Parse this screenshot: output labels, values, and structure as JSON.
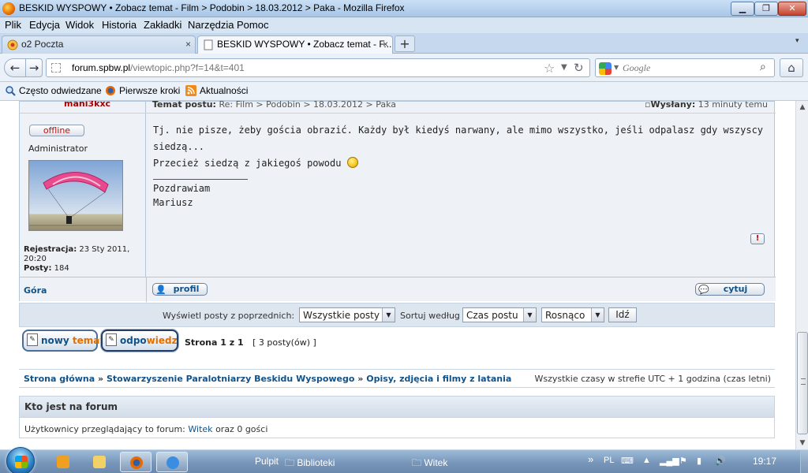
{
  "window": {
    "title": "BESKID WYSPOWY • Zobacz temat - Film > Podobin > 18.03.2012 > Paka - Mozilla Firefox",
    "controls": {
      "minimize": "▁",
      "maximize": "❐",
      "close": "✕"
    }
  },
  "menu": [
    "Plik",
    "Edycja",
    "Widok",
    "Historia",
    "Zakładki",
    "Narzędzia",
    "Pomoc"
  ],
  "tabs": [
    {
      "label": "o2 Poczta",
      "close": "×"
    },
    {
      "label": "BESKID WYSPOWY • Zobacz temat - F...",
      "close": "×"
    }
  ],
  "newtab_label": "+",
  "navigation": {
    "back": "←",
    "forward": "→",
    "url_domain": "forum.spbw.pl",
    "url_path": "/viewtopic.php?f=14&t=401",
    "search_placeholder": "Google",
    "home": "⌂"
  },
  "bookmarks": [
    {
      "label": "Często odwiedzane",
      "icon": "magnifier-bookmark-icon"
    },
    {
      "label": "Pierwsze kroki",
      "icon": "firefox-icon"
    },
    {
      "label": "Aktualności",
      "icon": "rss-icon"
    }
  ],
  "post": {
    "author": "mani3kxc",
    "subject_label": "Temat postu:",
    "subject": "Re: Film > Podobin > 18.03.2012 > Paka",
    "posted_label": "Wysłany:",
    "posted": "13 minuty temu",
    "status": "offline",
    "rank": "Administrator",
    "registration_label": "Rejestracja:",
    "registration": "23 Sty 2011, 20:20",
    "posts_label": "Posty:",
    "posts_count": "184",
    "body_line1": "Tj. nie pisze, żeby gościa obrazić. Każdy był kiedyś narwany, ale mimo wszystko, jeśli odpalasz gdy wszyscy siedzą...",
    "body_line2": "Przecież siedzą z jakiegoś powodu",
    "signature_line1": "Pozdrawiam",
    "signature_line2": "Mariusz",
    "report_label": "!",
    "top_link": "Góra",
    "profile_button": "profil",
    "quote_button": "cytuj"
  },
  "sort": {
    "show_label": "Wyświetl posty z poprzednich:",
    "show_value": "Wszystkie posty",
    "sort_label": "Sortuj według",
    "sort_value": "Czas postu",
    "order_value": "Rosnąco",
    "go_button": "Idź"
  },
  "actions": {
    "new_topic_a": "nowy ",
    "new_topic_b": "temat",
    "reply_a": "odpo",
    "reply_b": "wiedz"
  },
  "pagination": {
    "page_text": "Strona 1 z 1",
    "count_text": "[ 3 posty(ów) ]"
  },
  "breadcrumbs": {
    "items": [
      "Strona główna",
      "Stowarzyszenie Paralotniarzy Beskidu Wyspowego",
      "Opisy, zdjęcia i filmy z latania"
    ],
    "separator": "»",
    "timezone": "Wszystkie czasy w strefie UTC + 1 godzina (czas letni)"
  },
  "online": {
    "header": "Kto jest na forum",
    "text_before": "Użytkownicy przeglądający to forum:",
    "user": "Witek",
    "text_after": "oraz 0 gości"
  },
  "taskbar": {
    "desktop": "Pulpit",
    "libraries": "Biblioteki",
    "folder": "Witek",
    "overflow": "»",
    "lang": "PL",
    "time": "19:17"
  },
  "colors": {
    "link": "#105289",
    "author": "#aa0000",
    "accent_orange": "#e56e00",
    "post_bg": "#eef2f6"
  }
}
